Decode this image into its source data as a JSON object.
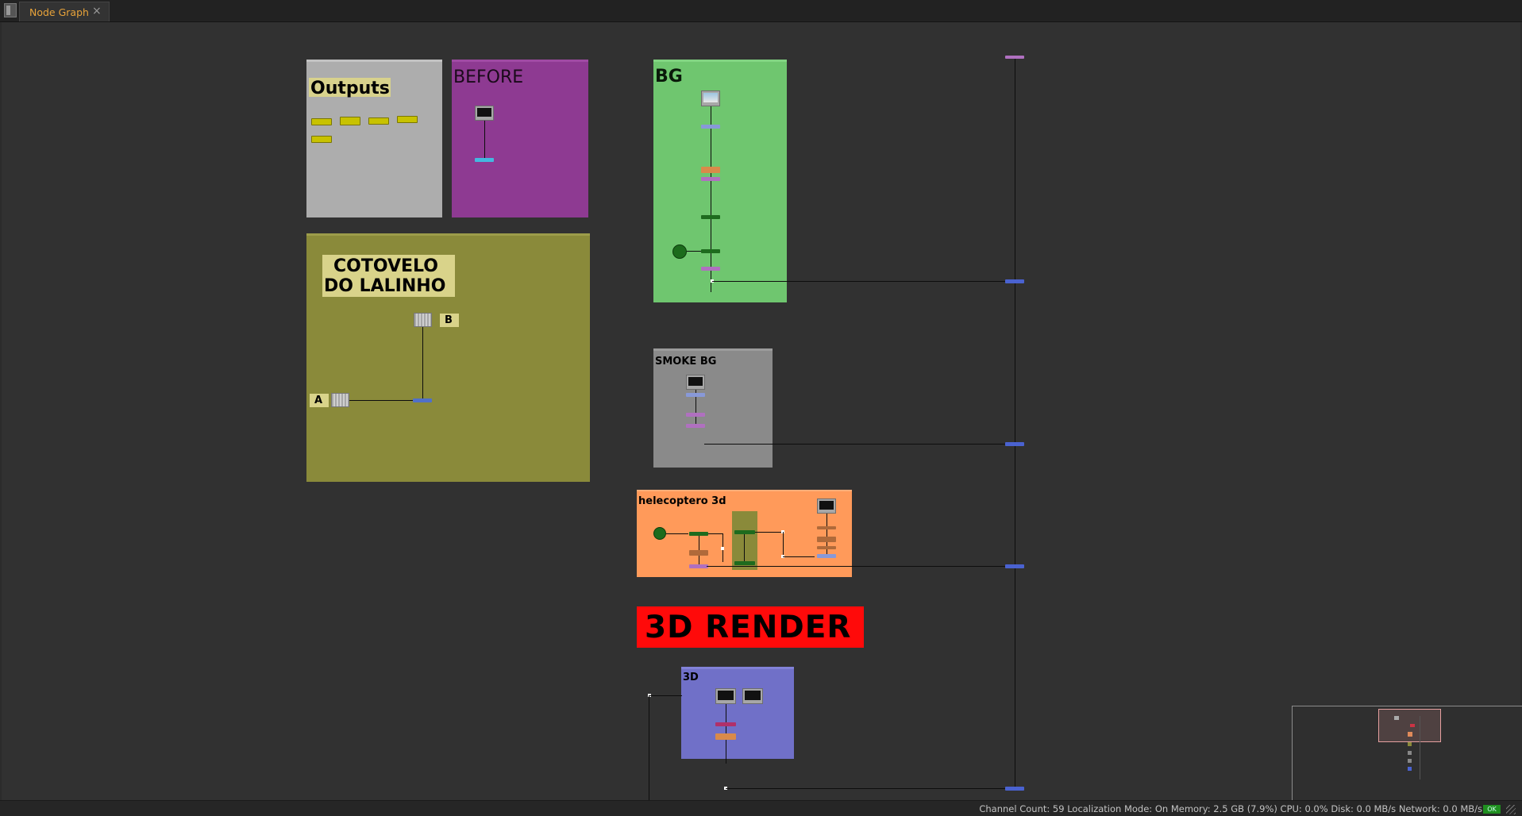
{
  "tab": {
    "label": "Node Graph",
    "close": "×"
  },
  "backdrops": {
    "outputs": {
      "title": "Outputs"
    },
    "before": {
      "title": "BEFORE"
    },
    "bg": {
      "title": "BG"
    },
    "cotovelo": {
      "line1": "COTOVELO",
      "line2": "DO LALINHO",
      "input_a": "A",
      "input_b": "B"
    },
    "smoke_bg": {
      "title": "SMOKE BG"
    },
    "helecoptero": {
      "title": "helecoptero 3d"
    },
    "render_3d": {
      "title": "3D RENDER"
    },
    "threed": {
      "title": "3D"
    }
  },
  "status": {
    "text": "Channel Count: 59  Localization Mode: On  Memory: 2.5 GB (7.9%)  CPU: 0.0%  Disk: 0.0 MB/s  Network: 0.0 MB/s",
    "ok": "OK"
  },
  "colors": {
    "outputs": "#adadad",
    "before": "#8e3a92",
    "bg": "#6fc66f",
    "cotovelo": "#8a8a3a",
    "smoke_bg": "#8a8a8a",
    "helecoptero": "#ff9a5a",
    "render_3d": "#ff0a0a",
    "threed": "#7070c8",
    "accent_tab": "#e8a33a"
  }
}
